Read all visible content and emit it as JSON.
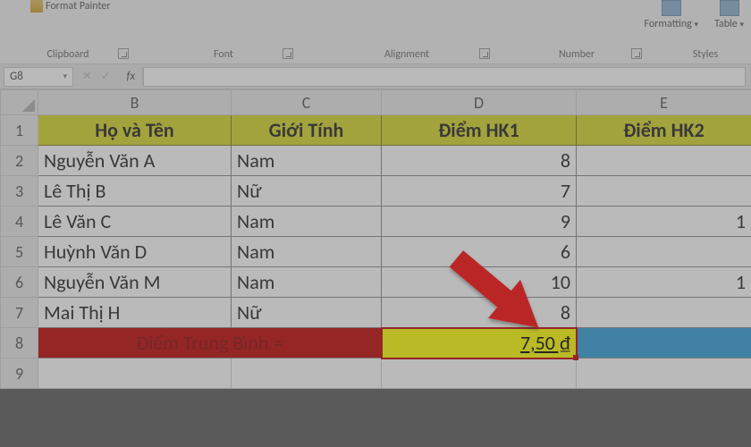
{
  "ribbon": {
    "format_painter": "Format Painter",
    "groups": {
      "clipboard": "Clipboard",
      "font": "Font",
      "alignment": "Alignment",
      "number": "Number",
      "styles": "Styles"
    },
    "right_buttons": {
      "formatting": "Formatting",
      "table": "Table"
    }
  },
  "namebox": "G8",
  "fx_label": "fx",
  "columns": [
    "B",
    "C",
    "D",
    "E"
  ],
  "row_numbers": [
    "1",
    "2",
    "3",
    "4",
    "5",
    "6",
    "7",
    "8",
    "9"
  ],
  "headers": {
    "B": "Họ và Tên",
    "C": "Giới Tính",
    "D": "Điểm HK1",
    "E": "Điểm HK2"
  },
  "rows": [
    {
      "B": "Nguyễn Văn A",
      "C": "Nam",
      "D": "8",
      "E": ""
    },
    {
      "B": "Lê Thị B",
      "C": "Nữ",
      "D": "7",
      "E": ""
    },
    {
      "B": "Lê Văn C",
      "C": "Nam",
      "D": "9",
      "E": "1"
    },
    {
      "B": "Huỳnh Văn D",
      "C": "Nam",
      "D": "6",
      "E": ""
    },
    {
      "B": "Nguyễn Văn M",
      "C": "Nam",
      "D": "10",
      "E": "1"
    },
    {
      "B": "Mai Thị H",
      "C": "Nữ",
      "D": "8",
      "E": ""
    }
  ],
  "average": {
    "label": "Điểm Trung Bình =",
    "value": "7,50 ₫"
  },
  "chart_data": {
    "type": "table",
    "title": "",
    "columns": [
      "Họ và Tên",
      "Giới Tính",
      "Điểm HK1",
      "Điểm HK2"
    ],
    "rows": [
      [
        "Nguyễn Văn A",
        "Nam",
        8,
        null
      ],
      [
        "Lê Thị B",
        "Nữ",
        7,
        null
      ],
      [
        "Lê Văn C",
        "Nam",
        9,
        1
      ],
      [
        "Huỳnh Văn D",
        "Nam",
        6,
        null
      ],
      [
        "Nguyễn Văn M",
        "Nam",
        10,
        1
      ],
      [
        "Mai Thị H",
        "Nữ",
        8,
        null
      ]
    ],
    "summary": {
      "label": "Điểm Trung Bình =",
      "value": 7.5,
      "formatted": "7,50 ₫"
    }
  }
}
